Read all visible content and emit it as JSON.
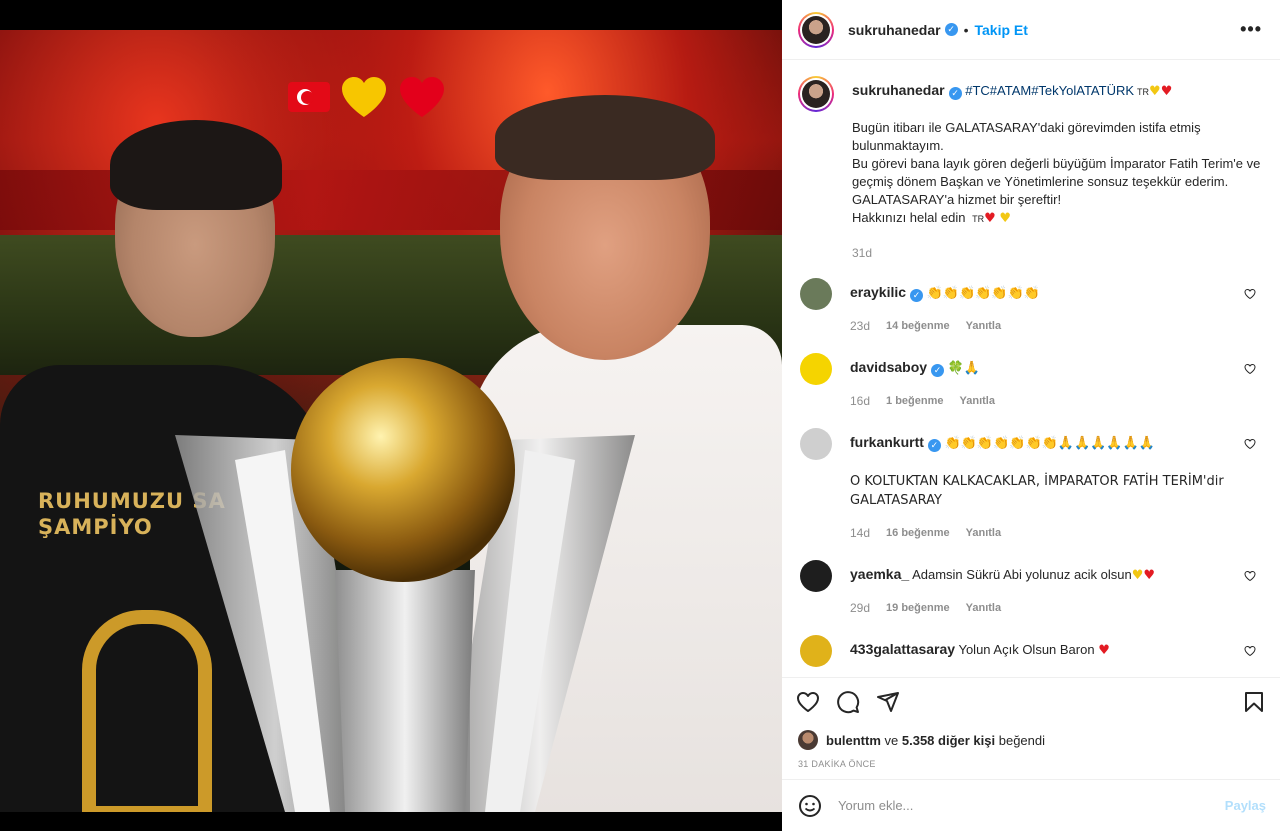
{
  "post": {
    "author": "sukruhanedar",
    "follow_label": "Takip Et",
    "more_label": "•••",
    "photo_alt": "Two men posing with the Süper Lig trophy",
    "photo_shirt_text": "RUHUMUZU SA   A\nŞAMPİYO"
  },
  "caption": {
    "username": "sukruhanedar",
    "hashtags": "#TC#ATAM#TekYolATATÜRK",
    "flag_text": "TR",
    "body": "Bugün itibarı ile GALATASARAY'daki görevimden istifa etmiş bulunmaktayım.\nBu görevi bana layık gören değerli büyüğüm İmparator Fatih Terim'e ve geçmiş dönem Başkan ve Yönetimlerine sonsuz teşekkür ederim.\nGALATASARAY'a hizmet bir şereftir!\nHakkınızı helal edin",
    "body_flag": "TR",
    "age": "31d"
  },
  "comments": [
    {
      "username": "eraykilic",
      "verified": true,
      "text": "👏👏👏👏👏👏👏",
      "age": "23d",
      "likes": "14 beğenme",
      "reply": "Yanıtla",
      "avatar_color": "#6a7a5a"
    },
    {
      "username": "davidsaboy",
      "verified": true,
      "text": "🍀🙏",
      "age": "16d",
      "likes": "1 beğenme",
      "reply": "Yanıtla",
      "avatar_color": "#f5d400"
    },
    {
      "username": "furkankurtt",
      "verified": true,
      "text": "👏👏👏👏👏👏👏🙏🙏🙏🙏🙏🙏\n\nO KOLTUKTAN KALKACAKLAR, İMPARATOR FATİH TERİM'dir GALATASARAY",
      "age": "14d",
      "likes": "16 beğenme",
      "reply": "Yanıtla",
      "avatar_color": "#cfcfcf"
    },
    {
      "username": "yaemka_",
      "verified": false,
      "text": "Adamsin Sükrü Abi yolunuz acik olsun",
      "age": "29d",
      "likes": "19 beğenme",
      "reply": "Yanıtla",
      "avatar_color": "#1e1e1e"
    },
    {
      "username": "433galattasaray",
      "verified": false,
      "text": "Yolun Açık Olsun Baron",
      "age": "",
      "likes": "",
      "reply": "",
      "avatar_color": "#e0b21a"
    }
  ],
  "likes": {
    "liker": "bulenttm",
    "conjunction": "ve",
    "others": "5.358 diğer kişi",
    "suffix": "beğendi"
  },
  "timestamp": "31 DAKİKA ÖNCE",
  "add_comment": {
    "placeholder": "Yorum ekle...",
    "post_label": "Paylaş"
  },
  "colors": {
    "link_blue": "#0095f6",
    "hashtag": "#00376b",
    "verified_blue": "#3897f0",
    "muted": "#8e8e8e"
  },
  "icons": [
    "heart-icon",
    "comment-icon",
    "share-icon",
    "bookmark-icon",
    "emoji-icon",
    "more-icon"
  ]
}
